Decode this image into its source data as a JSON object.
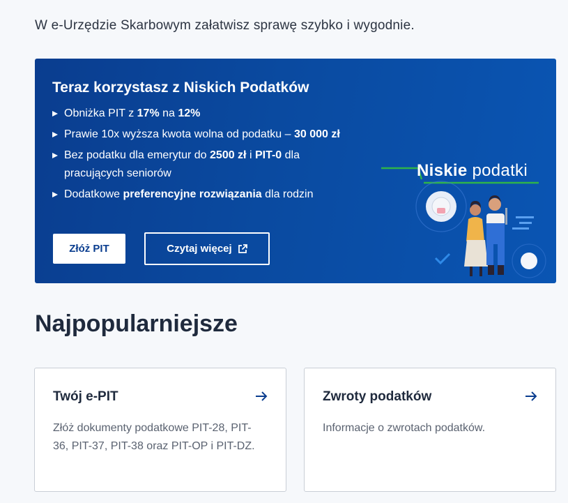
{
  "intro_text": "W e-Urzędzie Skarbowym załatwisz sprawę szybko i wygodnie.",
  "banner": {
    "title": "Teraz korzystasz z Niskich Podatków",
    "bullets": [
      {
        "t1": "Obniżka PIT z ",
        "b1": "17%",
        "t2": " na ",
        "b2": "12%",
        "t3": ""
      },
      {
        "t1": "Prawie 10x wyższa kwota wolna od podatku – ",
        "b1": "30 000 zł",
        "t2": "",
        "b2": "",
        "t3": ""
      },
      {
        "t1": "Bez podatku dla emerytur do ",
        "b1": "2500 zł",
        "t2": " i ",
        "b2": "PIT-0",
        "t3": " dla pracujących seniorów"
      },
      {
        "t1": "Dodatkowe ",
        "b1": "preferencyjne rozwiązania",
        "t2": " dla rodzin",
        "b2": "",
        "t3": ""
      }
    ],
    "primary_button": "Złóż PIT",
    "secondary_button": "Czytaj więcej",
    "logo_bold": "Niskie",
    "logo_light": "podatki"
  },
  "section_title": "Najpopularniejsze",
  "cards": [
    {
      "title": "Twój e-PIT",
      "desc": "Złóż dokumenty podatkowe PIT-28, PIT-36, PIT-37, PIT-38 oraz PIT-OP i PIT-DZ."
    },
    {
      "title": "Zwroty podatków",
      "desc": "Informacje o zwrotach podatków."
    }
  ],
  "colors": {
    "banner": "#0a4aa0",
    "accent_green": "#2fb34a",
    "text_dark": "#1f2a3d",
    "link_blue": "#0a3d8f"
  }
}
